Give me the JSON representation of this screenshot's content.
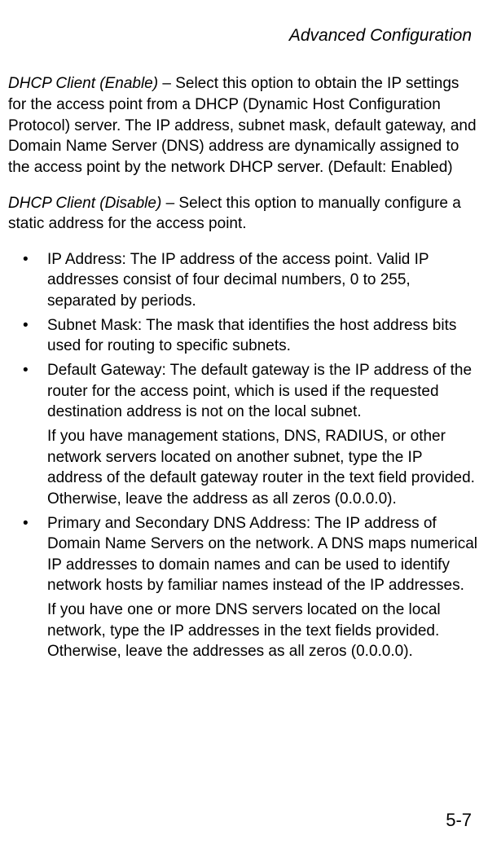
{
  "header": "Advanced Configuration",
  "section1": {
    "term": "DHCP Client (Enable)",
    "text": " – Select this option to obtain the IP settings for the access point from a DHCP (Dynamic Host Configuration Protocol) server. The IP address, subnet mask, default gateway, and Domain Name Server (DNS) address are dynamically assigned to the access point by the network DHCP server. (Default: Enabled)"
  },
  "section2": {
    "term": "DHCP Client (Disable)",
    "text": " – Select this option to manually configure a static address for the access point."
  },
  "bullets": {
    "b1": "IP Address: The IP address of the access point. Valid IP addresses consist of four decimal numbers, 0 to 255, separated by periods.",
    "b2": "Subnet Mask: The mask that identifies the host address bits used for routing to specific subnets.",
    "b3": "Default Gateway: The default gateway is the IP address of the router for the access point, which is used if the requested destination address is not on the local subnet.",
    "b3cont": "If you have management stations, DNS, RADIUS, or other network servers located on another subnet, type the IP address of the default gateway router in the text field provided. Otherwise, leave the address as all zeros (0.0.0.0).",
    "b4": "Primary and Secondary DNS Address: The IP address of Domain Name Servers on the network. A DNS maps numerical IP addresses to domain names and can be used to identify network hosts by familiar names instead of the IP addresses.",
    "b4cont": "If you have one or more DNS servers located on the local network, type the IP addresses in the text fields provided. Otherwise, leave the addresses as all zeros (0.0.0.0)."
  },
  "pageNumber": "5-7"
}
